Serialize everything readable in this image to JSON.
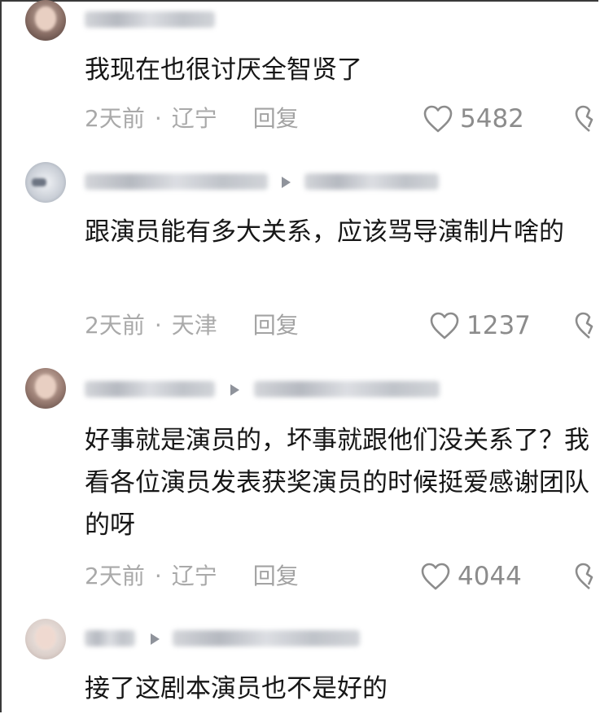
{
  "comments": [
    {
      "text": "我现在也很讨厌全智贤了",
      "time": "2天前",
      "region": "辽宁",
      "reply": "回复",
      "likes": "5482"
    },
    {
      "text": "跟演员能有多大关系，应该骂导演制片啥的",
      "time": "2天前",
      "region": "天津",
      "reply": "回复",
      "likes": "1237"
    },
    {
      "text": "好事就是演员的，坏事就跟他们没关系了？我看各位演员发表获奖演员的时候挺爱感谢团队的呀",
      "time": "2天前",
      "region": "辽宁",
      "reply": "回复",
      "likes": "4044"
    },
    {
      "text": "接了这剧本演员也不是好的"
    }
  ],
  "meta_separator": "·",
  "colors": {
    "text": "#161616",
    "meta": "#a9a9a9",
    "icon": "#8c8c8c"
  },
  "icons": [
    "heart-outline-icon",
    "broken-heart-icon",
    "reply-arrow-icon"
  ]
}
